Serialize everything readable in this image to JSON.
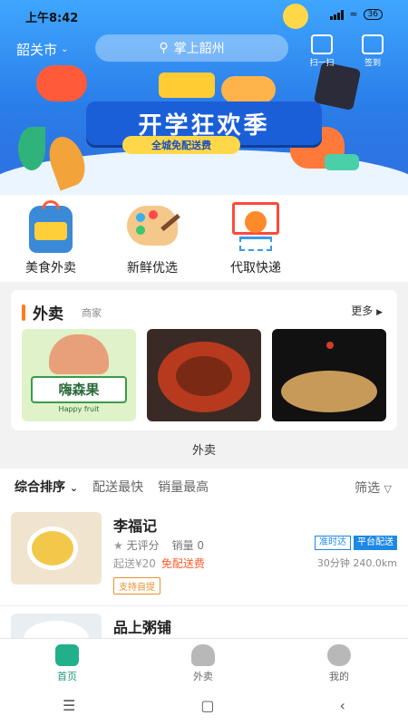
{
  "status": {
    "time": "上午8:42",
    "network": "4G",
    "battery": "36"
  },
  "header": {
    "city": "韶关市",
    "search_placeholder": "掌上韶州",
    "scan_label": "扫一扫",
    "checkin_label": "签到"
  },
  "banner": {
    "title": "开学狂欢季",
    "subtitle": "全城免配送费"
  },
  "categories": [
    {
      "label": "美食外卖",
      "icon": "backpack-icon"
    },
    {
      "label": "新鲜优选",
      "icon": "palette-icon"
    },
    {
      "label": "代取快递",
      "icon": "basketball-hoop-icon"
    }
  ],
  "takeout_card": {
    "title": "外卖",
    "subtitle": "商家",
    "more": "更多",
    "thumbs": [
      {
        "caption": "嗨森果",
        "caption_en": "Happy fruit"
      },
      {
        "caption": ""
      },
      {
        "caption": ""
      }
    ]
  },
  "section_label": "外卖",
  "sort": {
    "items": [
      "综合排序",
      "配送最快",
      "销量最高"
    ],
    "filter": "筛选"
  },
  "shops": [
    {
      "name": "李福记",
      "rating": "无评分",
      "sales": "销量 0",
      "min_order": "起送¥20",
      "delivery_fee": "免配送费",
      "tag_ontime": "准时达",
      "tag_platform": "平台配送",
      "eta": "30分钟 240.0km",
      "pickup": "支持自提"
    },
    {
      "name": "品上粥铺"
    }
  ],
  "tabs": [
    {
      "label": "首页",
      "icon": "home-icon"
    },
    {
      "label": "外卖",
      "icon": "burger-icon"
    },
    {
      "label": "我的",
      "icon": "user-icon"
    }
  ],
  "colors": {
    "primary": "#2a7de8",
    "accent": "#ff7a1a",
    "tab_active": "#22b08a",
    "tag_blue": "#1e88e5"
  }
}
